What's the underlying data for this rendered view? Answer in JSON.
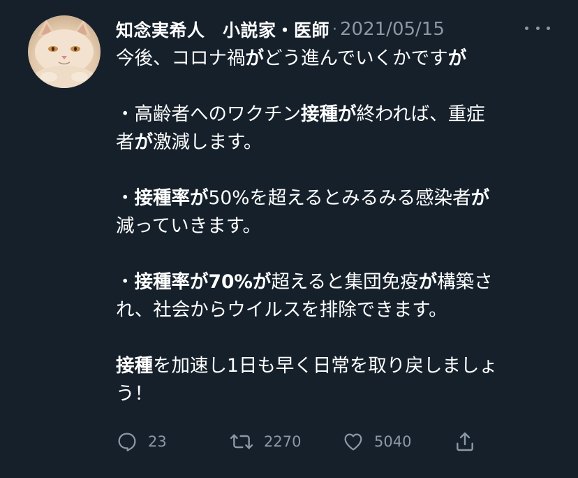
{
  "tweet": {
    "display_name": "知念実希人　小説家・医師",
    "separator": "·",
    "date": "2021/05/15",
    "more_icon": "more-horizontal-icon",
    "body": {
      "line1_a": "今後、コロナ禍",
      "line1_b": "が",
      "line1_c": "どう進んでいくかです",
      "line1_d": "が",
      "line2_a": "・高齢者へのワクチン",
      "line2_b": "接種が",
      "line2_c": "終われば、重症",
      "line3_a": "者",
      "line3_b": "が",
      "line3_c": "激減します。",
      "line4_a": "・",
      "line4_b": "接種率が",
      "line4_c": "50%を超えるとみるみる感染者",
      "line4_d": "が",
      "line5": "減っていきます。",
      "line6_a": "・",
      "line6_b": "接種率が70%が",
      "line6_c": "超えると集団免疫",
      "line6_d": "が",
      "line6_e": "構築さ",
      "line7": "れ、社会からウイルスを排除できます。",
      "line8_a": "接種",
      "line8_b": "を加速し1日も早く日常を取り戻しましょ",
      "line9": "う！"
    },
    "actions": {
      "reply_count": "23",
      "retweet_count": "2270",
      "like_count": "5040",
      "reply_icon": "reply-icon",
      "retweet_icon": "retweet-icon",
      "like_icon": "heart-icon",
      "share_icon": "share-icon"
    }
  },
  "colors": {
    "background": "#15202b",
    "text": "#ffffff",
    "secondary": "#8b98a5"
  }
}
